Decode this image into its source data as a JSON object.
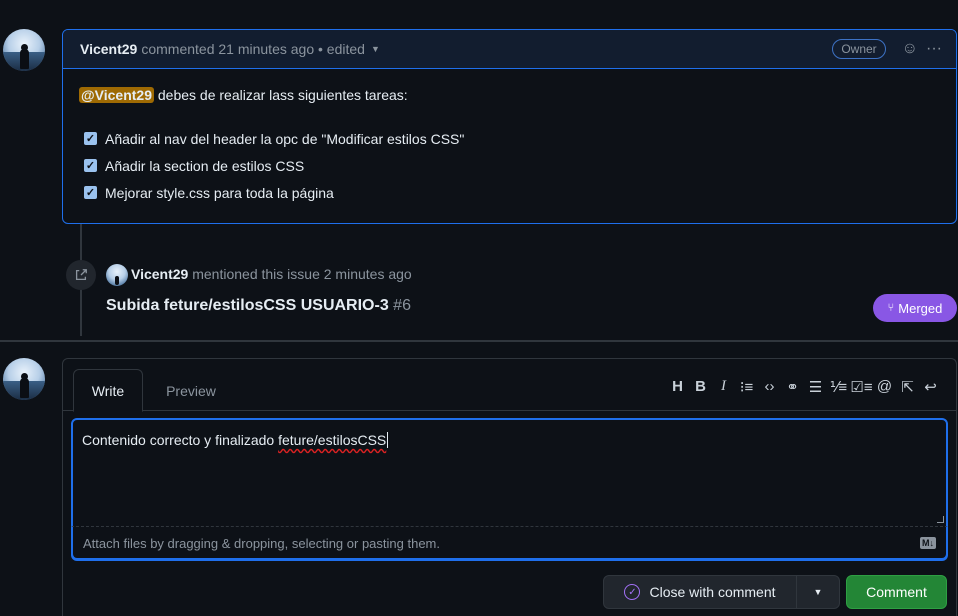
{
  "comment": {
    "author": "Vicent29",
    "meta": "commented 21 minutes ago • edited",
    "owner_badge": "Owner",
    "mention": "@Vicent29",
    "intro": " debes de realizar lass siguientes tareas:",
    "tasks": [
      "Añadir al nav del header la opc de \"Modificar estilos CSS\"",
      "Añadir la section de estilos CSS",
      "Mejorar style.css para toda la página"
    ]
  },
  "event": {
    "author": "Vicent29",
    "text": "mentioned this issue 2 minutes ago",
    "pr_title": "Subida feture/estilosCSS USUARIO-3",
    "pr_number": "#6",
    "status": "Merged"
  },
  "form": {
    "tab_write": "Write",
    "tab_preview": "Preview",
    "editor_text_plain": "Contenido correcto y finalizado ",
    "editor_text_typo": "feture/estilosCSS",
    "attach_hint": "Attach files by dragging & dropping, selecting or pasting them.",
    "markdown_icon": "M↓",
    "toolbar_icons": [
      "heading-icon",
      "bold-icon",
      "italic-icon",
      "quote-icon",
      "code-icon",
      "link-icon",
      "bullet-list-icon",
      "numbered-list-icon",
      "task-list-icon",
      "mention-icon",
      "reference-icon",
      "reply-icon"
    ],
    "close_label": "Close with comment",
    "comment_label": "Comment"
  },
  "colors": {
    "accent": "#1f6feb",
    "merged": "#8957e5",
    "comment_button": "#238636"
  }
}
